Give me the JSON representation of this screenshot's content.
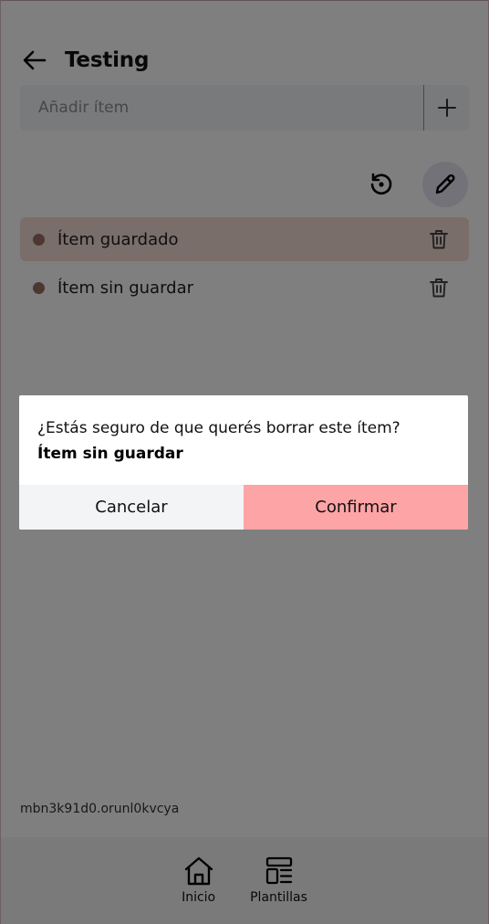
{
  "header": {
    "title": "Testing",
    "back_icon": "arrow-left-icon"
  },
  "add_item": {
    "placeholder": "Añadir ítem",
    "add_icon": "plus-icon"
  },
  "tools": {
    "restore_icon": "history-icon",
    "edit_icon": "pencil-icon"
  },
  "items": [
    {
      "label": "Ítem guardado",
      "state": "saved"
    },
    {
      "label": "Ítem sin guardar",
      "state": "unsaved"
    }
  ],
  "footer": {
    "id": "mbn3k91d0.orunl0kvcya"
  },
  "nav": [
    {
      "label": "Inicio",
      "icon": "home-icon"
    },
    {
      "label": "Plantillas",
      "icon": "template-icon"
    }
  ],
  "dialog": {
    "message": "¿Estás seguro de que querés borrar este ítem?",
    "item_name": "Ítem sin guardar",
    "cancel_label": "Cancelar",
    "confirm_label": "Confirmar"
  },
  "colors": {
    "saved_row": "#f4dcd4",
    "dot": "#9a6f67",
    "confirm": "#fda4a6",
    "edit_button_bg": "#e4e5f0"
  }
}
